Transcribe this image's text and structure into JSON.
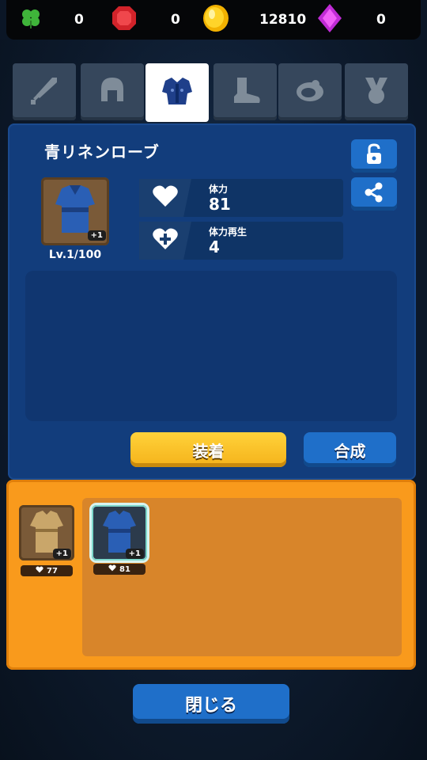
{
  "currencies": [
    {
      "icon": "clover-icon",
      "value": "0"
    },
    {
      "icon": "ruby-icon",
      "value": "0"
    },
    {
      "icon": "gold-coin-icon",
      "value": "12810"
    },
    {
      "icon": "purple-gem-icon",
      "value": "0"
    }
  ],
  "tabs": [
    {
      "icon": "sword-icon",
      "active": false
    },
    {
      "icon": "helmet-icon",
      "active": false
    },
    {
      "icon": "armor-icon",
      "active": true
    },
    {
      "icon": "boot-icon",
      "active": false
    },
    {
      "icon": "ring-icon",
      "active": false
    },
    {
      "icon": "medal-icon",
      "active": false
    }
  ],
  "item": {
    "name": "青リネンローブ",
    "plus": "+1",
    "level": "Lv.1/100",
    "stats": [
      {
        "icon": "heart-icon",
        "label": "体力",
        "value": "81"
      },
      {
        "icon": "heart-plus-icon",
        "label": "体力再生",
        "value": "4"
      }
    ]
  },
  "buttons": {
    "equip": "装着",
    "synthesize": "合成",
    "close": "閉じる"
  },
  "inventory": [
    {
      "name": "tan-tunic",
      "plus": "+1",
      "stat": "77",
      "selected": false
    },
    {
      "name": "blue-robe",
      "plus": "+1",
      "stat": "81",
      "selected": true
    }
  ],
  "colors": {
    "panel": "#123d7c",
    "inventory": "#f99a1c",
    "equip_button": "#ffc72a",
    "blue_button": "#1f6fc9"
  }
}
